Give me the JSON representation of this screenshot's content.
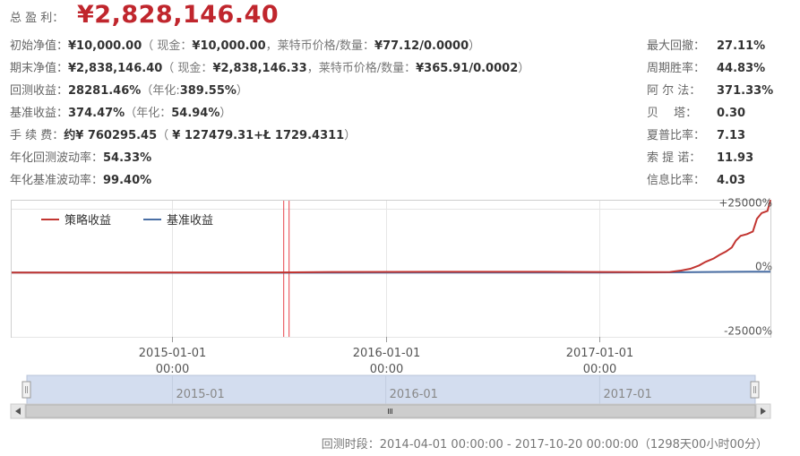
{
  "summary": {
    "total_profit_label": "总 盈 利：",
    "total_profit_value": "¥2,828,146.40",
    "init_nav_label": "初始净值：",
    "init_nav_value": "¥10,000.00",
    "init_nav_detail_a": "（ 现金：",
    "init_nav_cash": "¥10,000.00",
    "init_nav_detail_b": "，莱特币价格/数量：",
    "init_nav_ltc": "¥77.12/0.0000",
    "init_nav_detail_c": "）",
    "end_nav_label": "期末净值：",
    "end_nav_value": "¥2,838,146.40",
    "end_nav_detail_a": "（ 现金：",
    "end_nav_cash": "¥2,838,146.33",
    "end_nav_detail_b": "，莱特币价格/数量：",
    "end_nav_ltc": "¥365.91/0.0002",
    "end_nav_detail_c": "）",
    "backtest_return_label": "回测收益：",
    "backtest_return_value": "28281.46%",
    "backtest_return_annual_a": "（年化:",
    "backtest_return_annual": "389.55%",
    "backtest_return_annual_c": "）",
    "bench_return_label": "基准收益：",
    "bench_return_value": "374.47%",
    "bench_return_annual_a": "（年化：",
    "bench_return_annual": "54.94%",
    "bench_return_annual_c": "）",
    "fee_label": "手 续 费：",
    "fee_value": "约¥ 760295.45",
    "fee_detail_a": "（ ",
    "fee_detail": "¥ 127479.31+Ł 1729.4311",
    "fee_detail_c": "）",
    "vol_label": "年化回测波动率：",
    "vol_value": "54.33%",
    "bench_vol_label": "年化基准波动率：",
    "bench_vol_value": "99.40%"
  },
  "metrics": [
    {
      "label": "最大回撤：",
      "value": "27.11%"
    },
    {
      "label": "周期胜率：",
      "value": "44.83%"
    },
    {
      "label": "阿 尔 法：",
      "value": "371.33%"
    },
    {
      "label": "贝　 塔：",
      "value": "0.30"
    },
    {
      "label": "夏普比率：",
      "value": "7.13"
    },
    {
      "label": "索 提 诺：",
      "value": "11.93"
    },
    {
      "label": "信息比率：",
      "value": "4.03"
    }
  ],
  "colors": {
    "strategy": "#c23531",
    "benchmark": "#4a6fa5",
    "accent": "#c0262d",
    "marker": "#e8434b"
  },
  "chart_data": {
    "type": "line",
    "x_range": [
      "2014-04-01",
      "2017-10-20"
    ],
    "xticks": [
      {
        "date": "2015-01-01",
        "line1": "2015-01-01",
        "line2": "00:00"
      },
      {
        "date": "2016-01-01",
        "line1": "2016-01-01",
        "line2": "00:00"
      },
      {
        "date": "2017-01-01",
        "line1": "2017-01-01",
        "line2": "00:00"
      }
    ],
    "yticks": [
      {
        "value": 25000,
        "label": "+25000%"
      },
      {
        "value": 0,
        "label": "0%"
      },
      {
        "value": -25000,
        "label": "-25000%"
      }
    ],
    "ylim": [
      -25000,
      28000
    ],
    "grid": true,
    "legend_position": "top-left",
    "marker_date": "2015-07-15",
    "series": [
      {
        "name": "策略收益",
        "points": [
          [
            "2014-04-01",
            0
          ],
          [
            "2014-10-01",
            30
          ],
          [
            "2015-04-01",
            60
          ],
          [
            "2015-07-01",
            80
          ],
          [
            "2015-10-01",
            250
          ],
          [
            "2016-04-01",
            300
          ],
          [
            "2016-10-01",
            320
          ],
          [
            "2017-01-01",
            260
          ],
          [
            "2017-04-01",
            200
          ],
          [
            "2017-05-01",
            250
          ],
          [
            "2017-05-20",
            800
          ],
          [
            "2017-06-05",
            1500
          ],
          [
            "2017-06-20",
            2800
          ],
          [
            "2017-07-01",
            4200
          ],
          [
            "2017-07-15",
            5500
          ],
          [
            "2017-07-25",
            6900
          ],
          [
            "2017-08-05",
            8200
          ],
          [
            "2017-08-15",
            9800
          ],
          [
            "2017-08-22",
            12500
          ],
          [
            "2017-08-30",
            14300
          ],
          [
            "2017-09-10",
            15000
          ],
          [
            "2017-09-20",
            16000
          ],
          [
            "2017-09-27",
            21000
          ],
          [
            "2017-10-05",
            23200
          ],
          [
            "2017-10-15",
            24000
          ],
          [
            "2017-10-20",
            28281.46
          ]
        ]
      },
      {
        "name": "基准收益",
        "points": [
          [
            "2014-04-01",
            0
          ],
          [
            "2014-10-01",
            -40
          ],
          [
            "2015-04-01",
            -60
          ],
          [
            "2015-10-01",
            -30
          ],
          [
            "2016-04-01",
            -10
          ],
          [
            "2016-10-01",
            20
          ],
          [
            "2017-01-01",
            30
          ],
          [
            "2017-05-01",
            100
          ],
          [
            "2017-07-01",
            250
          ],
          [
            "2017-08-15",
            320
          ],
          [
            "2017-09-15",
            360
          ],
          [
            "2017-10-20",
            374.47
          ]
        ]
      }
    ]
  },
  "navigator": {
    "labels": [
      "2015-01",
      "2016-01",
      "2017-01"
    ],
    "scroll_left_icon": "left-triangle-icon",
    "scroll_right_icon": "right-triangle-icon",
    "scroll_thumb_icon": "grip-icon"
  },
  "footer": {
    "period": "回测时段：2014-04-01 00:00:00 - 2017-10-20 00:00:00（1298天00小时00分）"
  }
}
